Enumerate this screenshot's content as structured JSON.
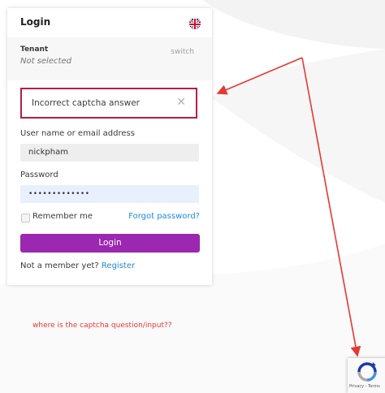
{
  "login": {
    "title": "Login",
    "language_icon": "uk-flag-icon"
  },
  "tenant": {
    "label": "Tenant",
    "value": "Not selected",
    "switch_label": "switch"
  },
  "alert": {
    "message": "Incorrect captcha answer",
    "close_symbol": "✕"
  },
  "form": {
    "username_label": "User name or email address",
    "username_value": "nickpham",
    "password_label": "Password",
    "password_value": "•••••••••••••",
    "remember_label": "Remember me",
    "remember_checked": false,
    "forgot_label": "Forgot password?",
    "login_label": "Login",
    "member_prompt": "Not a member yet?",
    "register_label": "Register"
  },
  "annotation": {
    "text": "where is the captcha question/input??"
  },
  "recaptcha": {
    "links": "Privacy - Terms"
  },
  "colors": {
    "accent": "#9c27b0",
    "link": "#1e88e5",
    "error_border": "#b71c4a",
    "annotation_red": "#e53935"
  }
}
